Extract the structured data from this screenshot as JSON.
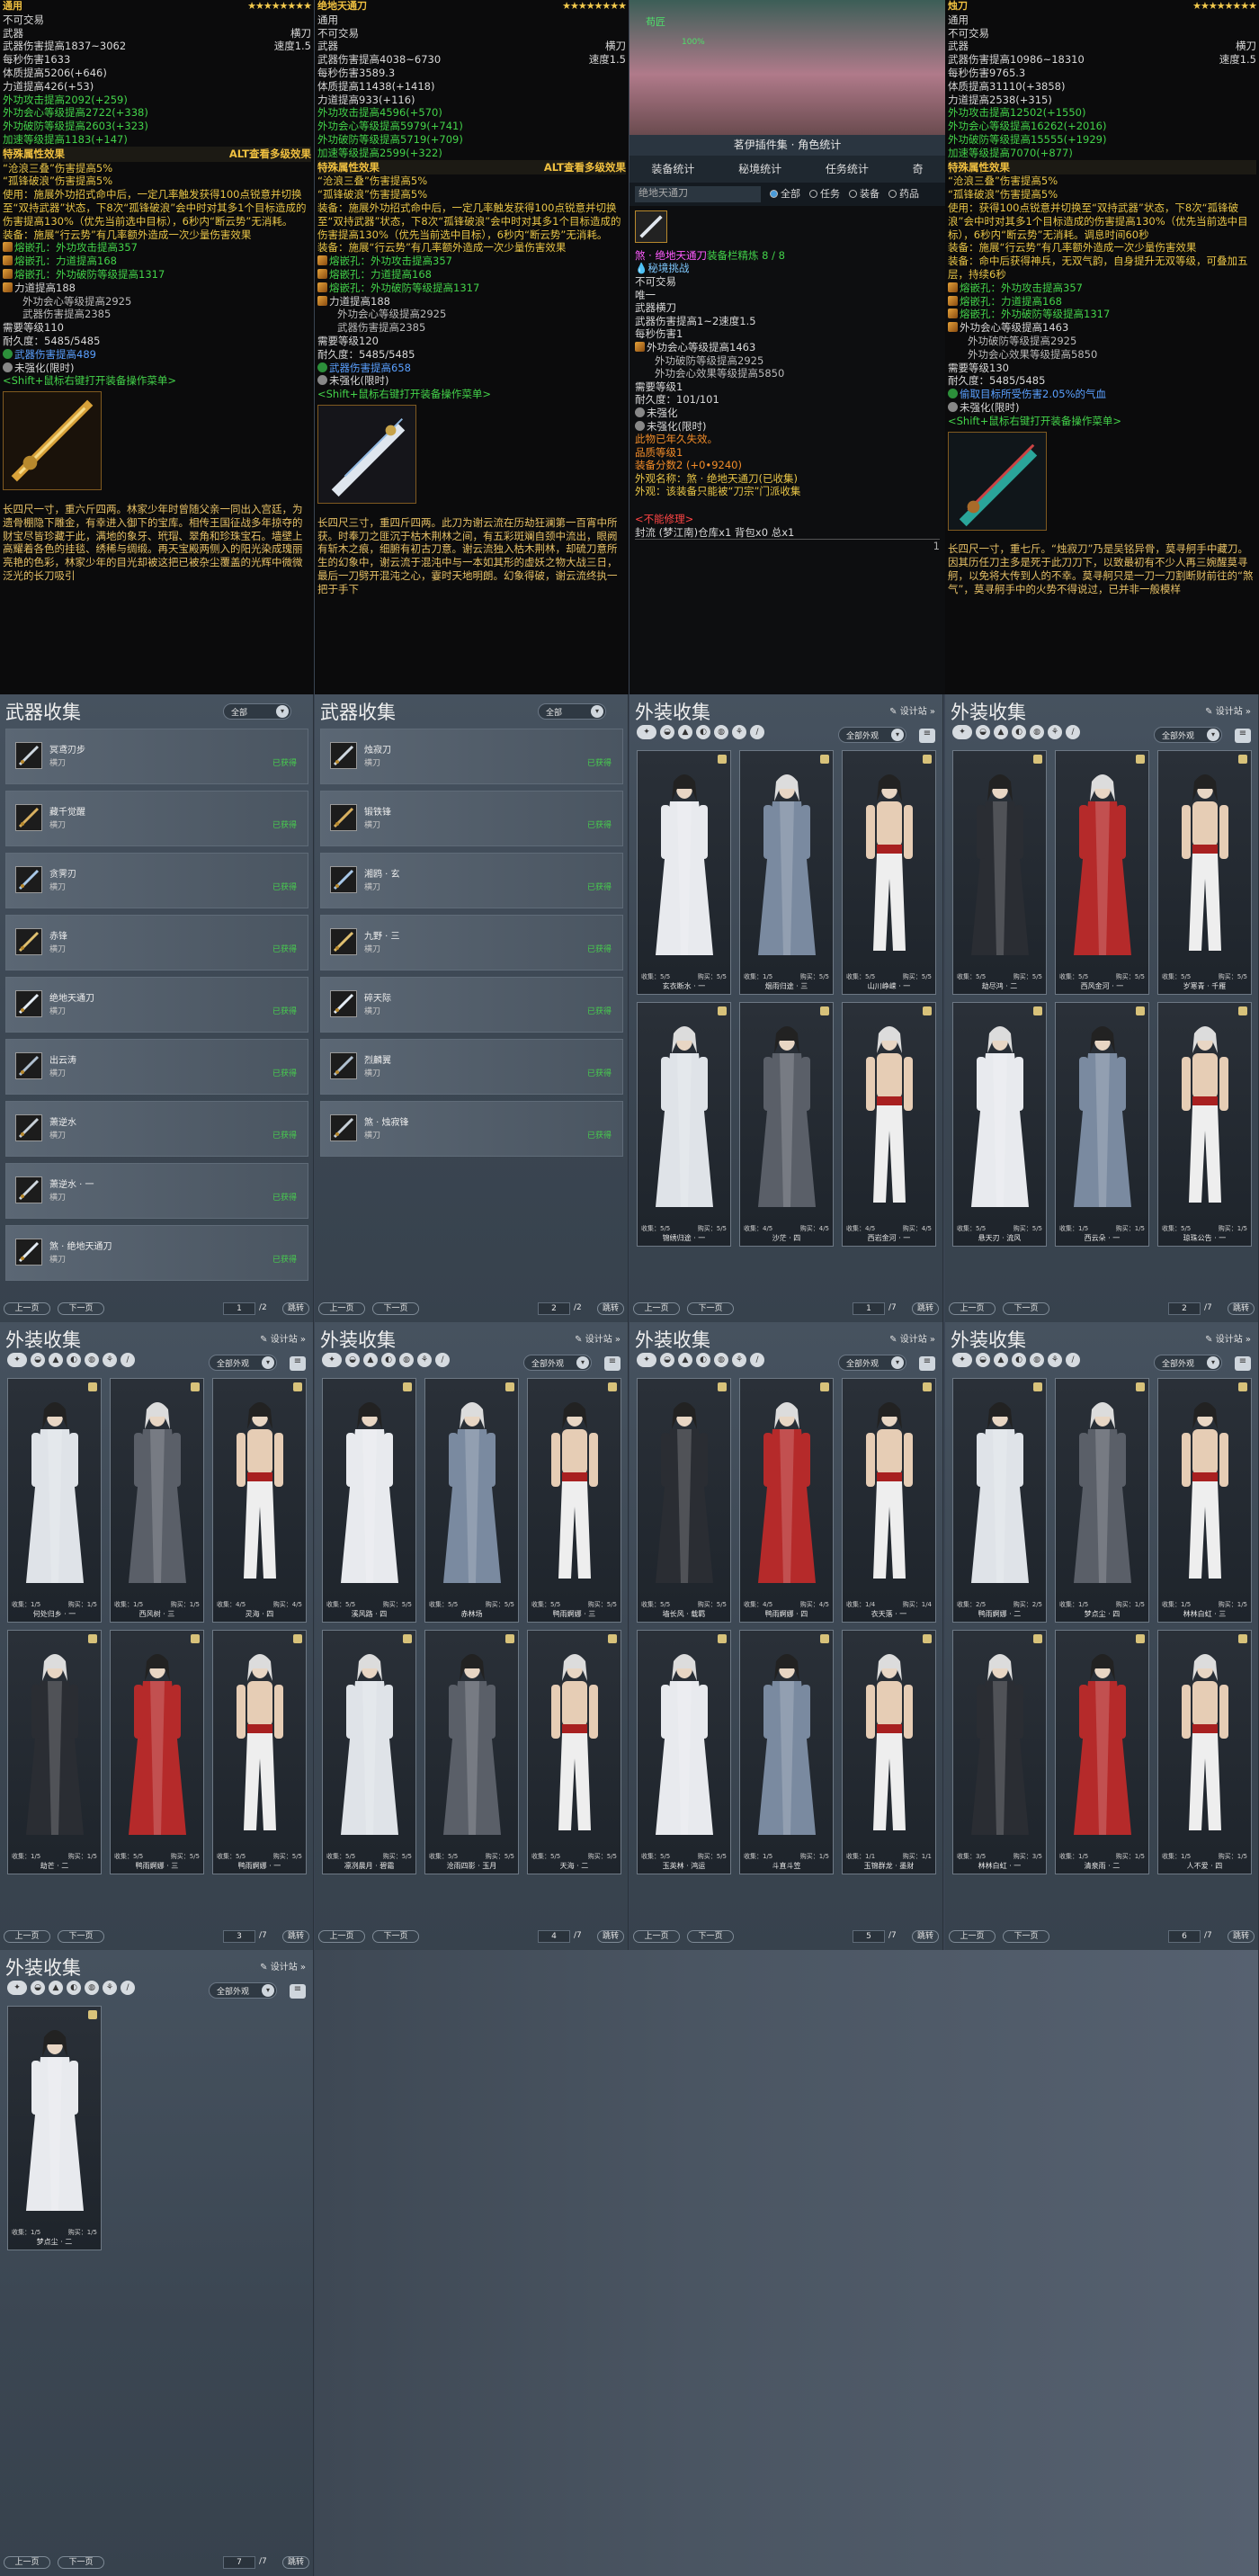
{
  "tooltip1": {
    "title": "通用",
    "stars": "★★★★★★★★",
    "lines": [
      "不可交易"
    ],
    "weapon_row": [
      "武器",
      "横刀"
    ],
    "dmg_row": [
      "武器伤害提高1837~3062",
      "速度1.5"
    ],
    "stats": [
      "每秒伤害1633",
      "体质提高5206(+646)",
      "力道提高426(+53)"
    ],
    "green_stats": [
      "外功攻击提高2092(+259)",
      "外功会心等级提高2722(+338)",
      "外功破防等级提高2603(+323)",
      "加速等级提高1183(+147)"
    ],
    "sec_left": "特殊属性效果",
    "sec_right": "ALT查看多级效果",
    "fx": [
      "“沧浪三叠”伤害提高5%",
      "“孤锋破浪”伤害提高5%"
    ],
    "equip": "使用：施展外功招式命中后，一定几率触发获得100点锐意并切换至“双持武器”状态，下8次“孤锋破浪”会中时对其多1个目标造成的伤害提高130%（优先当前选中目标），6秒内“断云势”无消耗。",
    "equip2": "装备：施展“行云势”有几率额外造成一次少量伤害效果",
    "gems": [
      "熔嵌孔：外功攻击提高357",
      "熔嵌孔：力道提高168",
      "熔嵌孔：外功破防等级提高1317"
    ],
    "extra": [
      "力道提高188",
      "外功会心等级提高2925",
      "武器伤害提高2385"
    ],
    "req": "需要等级110",
    "dur": "耐久度：5485/5485",
    "wdmg": "武器伤害提高489",
    "unrein": "未强化(限时)",
    "shift": "<Shift+鼠标右键打开装备操作菜单>",
    "lore": "长四尺一寸，重六斤四两。林家少年时曾随父亲一同出入宫廷，为遗骨棚隐下雕金，有幸进入御下的宝库。相传王国征战多年掠夺的财宝尽皆珍藏于此，满地的象牙、玳瑁、翠角和珍珠宝石。墙壁上高耀着各色的挂毯、绣稀与绸缎。再天宝殿两侧入的阳光染成瑰丽亮艳的色彩，林家少年的目光却被这把已被杂尘覆盖的光辉中微微泛光的长刀吸引"
  },
  "tooltip2": {
    "title": "绝地天通刀",
    "stars": "★★★★★★★★",
    "lines": [
      "通用",
      "不可交易"
    ],
    "weapon_row": [
      "武器",
      "横刀"
    ],
    "dmg_row": [
      "武器伤害提高4038~6730",
      "速度1.5"
    ],
    "stats": [
      "每秒伤害3589.3",
      "体质提高11438(+1418)",
      "力道提高933(+116)"
    ],
    "green_stats": [
      "外功攻击提高4596(+570)",
      "外功会心等级提高5979(+741)",
      "外功破防等级提高5719(+709)",
      "加速等级提高2599(+322)"
    ],
    "sec_left": "特殊属性效果",
    "sec_right": "ALT查看多级效果",
    "fx": [
      "“沧浪三叠”伤害提高5%",
      "“孤锋破浪”伤害提高5%"
    ],
    "equip": "装备：施展外功招式命中后，一定几率触发获得100点锐意并切换至“双持武器”状态，下8次“孤锋破浪”会中时对其多1个目标造成的伤害提高130%（优先当前选中目标），6秒内“断云势”无消耗。",
    "equip2": "装备：施展“行云势”有几率额外造成一次少量伤害效果",
    "gems": [
      "熔嵌孔：外功攻击提高357",
      "熔嵌孔：力道提高168",
      "熔嵌孔：外功破防等级提高1317"
    ],
    "extra": [
      "力道提高188",
      "外功会心等级提高2925",
      "武器伤害提高2385"
    ],
    "req": "需要等级120",
    "dur": "耐久度：5485/5485",
    "wdmg": "武器伤害提高658",
    "unrein": "未强化(限时)",
    "shift": "<Shift+鼠标右键打开装备操作菜单>",
    "lore": "长四尺三寸，重四斤四两。此刀为谢云流在历劫狂澜第一百宵中所获。时奉刀之匪沉于枯木荆林之间，有五彩斑斓自颈中流出，眼阙有斩木之痕，细腑有初古刀意。谢云流独入枯木荆林，却硫刀意所生的幻象中，谢云流于混沌中与一本如其形的虚妖之物大战三日，最后一刀劈开混沌之心，霎时天地明朗。幻象得破，谢云流终执一把于手下"
  },
  "popup": {
    "name_tag": "苟匠",
    "hp": "100%",
    "header": "茗伊插件集 · 角色统计",
    "tabs": [
      "装备统计",
      "秘境统计",
      "任务统计",
      "奇"
    ],
    "search": "绝地天通刀",
    "radios": [
      "全部",
      "任务",
      "装备",
      "药品"
    ],
    "item": {
      "name": "煞 · 绝地天通刀",
      "refine": "装备栏精炼 8 / 8",
      "tags": [
        "秘境挑战",
        "不可交易",
        "唯一"
      ],
      "weapon_row": [
        "武器",
        "横刀"
      ],
      "dmg_row": [
        "武器伤害提高1~2",
        "速度1.5"
      ],
      "dps": "每秒伤害1",
      "gems": [
        "外功会心等级提高1463",
        "外功破防等级提高2925",
        "外功会心效果等级提高5850"
      ],
      "req": "需要等级1",
      "dur": "耐久度：101/101",
      "unrein": "未强化",
      "unrein2": "未强化(限时)",
      "expire": "此物已年久失效。",
      "quality": "品质等级1",
      "score": "装备分数2 (+0•9240)",
      "appearance": "外观名称：煞 · 绝地天通刀(已收集)",
      "look": "外观：该装备只能被“刀宗”门派收集",
      "no_repair": "<不能修理>",
      "seal": "封流 (梦江南)",
      "bag": "仓库x1 背包x0 总x1",
      "pg": "1"
    }
  },
  "tooltip3": {
    "title": "烛刀",
    "stars": "★★★★★★★★",
    "lines": [
      "通用",
      "不可交易"
    ],
    "weapon_row": [
      "武器",
      "横刀"
    ],
    "dmg_row": [
      "武器伤害提高10986~18310",
      "速度1.5"
    ],
    "stats": [
      "每秒伤害9765.3",
      "体质提高31110(+3858)",
      "力道提高2538(+315)"
    ],
    "green_stats": [
      "外功攻击提高12502(+1550)",
      "外功会心等级提高16262(+2016)",
      "外功破防等级提高15555(+1929)",
      "加速等级提高7070(+877)"
    ],
    "sec_left": "特殊属性效果",
    "sec_right": "",
    "fx": [
      "“沧浪三叠”伤害提高5%",
      "“孤锋破浪”伤害提高5%"
    ],
    "equip": "使用：获得100点锐意并切换至“双持武器”状态，下8次“孤锋破浪”会中时对其多1个目标造成的伤害提高130%（优先当前选中目标），6秒内“断云势”无消耗。调息时间60秒",
    "equip2": "装备：施展“行云势”有几率额外造成一次少量伤害效果",
    "equip3": "装备：命中后获得神兵，无双气韵，自身提升无双等级，可叠加五层，持续6秒",
    "gems": [
      "熔嵌孔：外功攻击提高357",
      "熔嵌孔：力道提高168",
      "熔嵌孔：外功破防等级提高1317"
    ],
    "extra": [
      "外功会心等级提高1463",
      "外功破防等级提高2925",
      "外功会心效果等级提高5850"
    ],
    "req": "需要等级130",
    "dur": "耐久度：5485/5485",
    "wdmg": "偷取目标所受伤害2.05%的气血",
    "unrein": "未强化(限时)",
    "shift": "<Shift+鼠标右键打开装备操作菜单>",
    "lore": "长四尺一寸，重七斤。“烛寂刀”乃是吴铭异骨，莫寻舸手中藏刀。因其历任刀主多是死于此刀刀下，以致最初有不少人再三婉醒莫寻舸，以免将大传到人的不幸。莫寻舸只是一刀一刀割断财前往的“煞气”，莫寻舸手中的火势不得说过，已并非一般模样"
  },
  "panels": {
    "design": "设计站",
    "weapon_title": "武器收集",
    "all": "全部",
    "all_outfits": "全部外观",
    "prev": "上一页",
    "next": "下一页",
    "jump": "跳转",
    "outfit_title": "外装收集",
    "wlist1": [
      {
        "name": "冥鸢刃步",
        "type": "横刀",
        "status": "已获得"
      },
      {
        "name": "藏千觉醒",
        "type": "横刀",
        "status": "已获得"
      },
      {
        "name": "贪霁刃",
        "type": "横刀",
        "status": "已获得"
      },
      {
        "name": "赤锋",
        "type": "横刀",
        "status": "已获得"
      },
      {
        "name": "绝地天通刀",
        "type": "横刀",
        "status": "已获得"
      },
      {
        "name": "出云涛",
        "type": "横刀",
        "status": "已获得"
      },
      {
        "name": "萧逆水",
        "type": "横刀",
        "status": "已获得"
      },
      {
        "name": "萧逆水 · 一",
        "type": "横刀",
        "status": "已获得"
      },
      {
        "name": "煞 · 绝地天通刀",
        "type": "横刀",
        "status": "已获得"
      }
    ],
    "wlist1_page": "1",
    "wlist1_total": "/2",
    "wlist2": [
      {
        "name": "烛寂刀",
        "type": "横刀",
        "status": "已获得"
      },
      {
        "name": "锻铁锋",
        "type": "横刀",
        "status": "已获得"
      },
      {
        "name": "湘鸥 · 玄",
        "type": "横刀",
        "status": "已获得"
      },
      {
        "name": "九野 · 三",
        "type": "横刀",
        "status": "已获得"
      },
      {
        "name": "碎天际",
        "type": "横刀",
        "status": "已获得"
      },
      {
        "name": "烈麟翼",
        "type": "横刀",
        "status": "已获得"
      },
      {
        "name": "煞 · 烛寂锋",
        "type": "横刀",
        "status": "已获得"
      }
    ],
    "wlist2_page": "2",
    "wlist2_total": "/2",
    "outfits": [
      {
        "page": "1",
        "total": "/7",
        "items": [
          {
            "name": "玄衣断水 · 一",
            "s": [
              "收集：5/5",
              "购买：5/5"
            ]
          },
          {
            "name": "烟雨归途 · 三",
            "s": [
              "收集：1/5",
              "购买：5/5"
            ]
          },
          {
            "name": "山川峥嵘 · 一",
            "s": [
              "收集：5/5",
              "购买：5/5"
            ]
          },
          {
            "name": "锦绣归途 · 一",
            "s": [
              "收集：5/5",
              "购买：5/5"
            ]
          },
          {
            "name": "沙茫 · 四",
            "s": [
              "收集：4/5",
              "购买：4/5"
            ]
          },
          {
            "name": "西岩金河 · 一",
            "s": [
              "收集：4/5",
              "购买：4/5"
            ]
          }
        ]
      },
      {
        "page": "2",
        "total": "/7",
        "items": [
          {
            "name": "劫尽鸿 · 二",
            "s": [
              "收集：5/5",
              "购买：5/5"
            ]
          },
          {
            "name": "西风金河 · 一",
            "s": [
              "收集：5/5",
              "购买：5/5"
            ]
          },
          {
            "name": "岁寒青 · 千雁",
            "s": [
              "收集：5/5",
              "购买：5/5"
            ]
          },
          {
            "name": "悬天刃 · 流风",
            "s": [
              "收集：5/5",
              "购买：5/5"
            ]
          },
          {
            "name": "西云朵 · 一",
            "s": [
              "收集：1/5",
              "购买：1/5"
            ]
          },
          {
            "name": "琼珠公告 · 一",
            "s": [
              "收集：5/5",
              "购买：1/5"
            ]
          }
        ]
      },
      {
        "page": "3",
        "total": "/7",
        "items": [
          {
            "name": "何处归乡 · 一",
            "s": [
              "收集：1/5",
              "购买：1/5"
            ]
          },
          {
            "name": "西风树 · 三",
            "s": [
              "收集：1/5",
              "购买：1/5"
            ]
          },
          {
            "name": "灵海 · 四",
            "s": [
              "收集：4/5",
              "购买：4/5"
            ]
          },
          {
            "name": "劫芒 · 二",
            "s": [
              "收集：1/5",
              "购买：1/5"
            ]
          },
          {
            "name": "鸭雨婀娜 · 三",
            "s": [
              "收集：5/5",
              "购买：5/5"
            ]
          },
          {
            "name": "鸭雨婀娜 · 一",
            "s": [
              "收集：5/5",
              "购买：5/5"
            ]
          }
        ]
      },
      {
        "page": "4",
        "total": "/7",
        "items": [
          {
            "name": "溪风路 · 四",
            "s": [
              "收集：5/5",
              "购买：5/5"
            ]
          },
          {
            "name": "赤林场",
            "s": [
              "收集：5/5",
              "购买：5/5"
            ]
          },
          {
            "name": "鸭雨婀娜 · 三",
            "s": [
              "收集：5/5",
              "购买：5/5"
            ]
          },
          {
            "name": "凛冽晨月 · 碧霜",
            "s": [
              "收集：5/5",
              "购买：5/5"
            ]
          },
          {
            "name": "沧雨四影 · 玉月",
            "s": [
              "收集：5/5",
              "购买：5/5"
            ]
          },
          {
            "name": "天海 · 二",
            "s": [
              "收集：5/5",
              "购买：5/5"
            ]
          }
        ]
      },
      {
        "page": "5",
        "total": "/7",
        "items": [
          {
            "name": "墙长风 · 载羁",
            "s": [
              "收集：5/5",
              "购买：5/5"
            ]
          },
          {
            "name": "鸭雨婀娜 · 四",
            "s": [
              "收集：4/5",
              "购买：4/5"
            ]
          },
          {
            "name": "衣天落 · 一",
            "s": [
              "收集：1/4",
              "购买：1/4"
            ]
          },
          {
            "name": "玉英林 · 鸿运",
            "s": [
              "收集：5/5",
              "购买：5/5"
            ]
          },
          {
            "name": "斗直斗笠",
            "s": [
              "收集：1/5",
              "购买：1/5"
            ]
          },
          {
            "name": "玉锦群龙 · 墨财",
            "s": [
              "收集：1/1",
              "购买：1/1"
            ]
          }
        ]
      },
      {
        "page": "6",
        "total": "/7",
        "items": [
          {
            "name": "鸭雨婀娜 · 二",
            "s": [
              "收集：2/5",
              "购买：2/5"
            ]
          },
          {
            "name": "梦点尘 · 四",
            "s": [
              "收集：1/5",
              "购买：1/5"
            ]
          },
          {
            "name": "林林白虹 · 三",
            "s": [
              "收集：1/5",
              "购买：1/5"
            ]
          },
          {
            "name": "林林白虹 · 一",
            "s": [
              "收集：3/5",
              "购买：3/5"
            ]
          },
          {
            "name": "清泉雨 · 二",
            "s": [
              "收集：1/5",
              "购买：1/5"
            ]
          },
          {
            "name": "人不爱 · 四",
            "s": [
              "收集：1/5",
              "购买：1/5"
            ]
          }
        ]
      },
      {
        "page": "7",
        "total": "/7",
        "items": [
          {
            "name": "梦点尘 · 二",
            "s": [
              "收集：1/5",
              "购买：1/5"
            ]
          }
        ]
      }
    ]
  },
  "colors": {
    "gold": "#f0c040",
    "green": "#43d34a",
    "bg": "#3a4452"
  }
}
